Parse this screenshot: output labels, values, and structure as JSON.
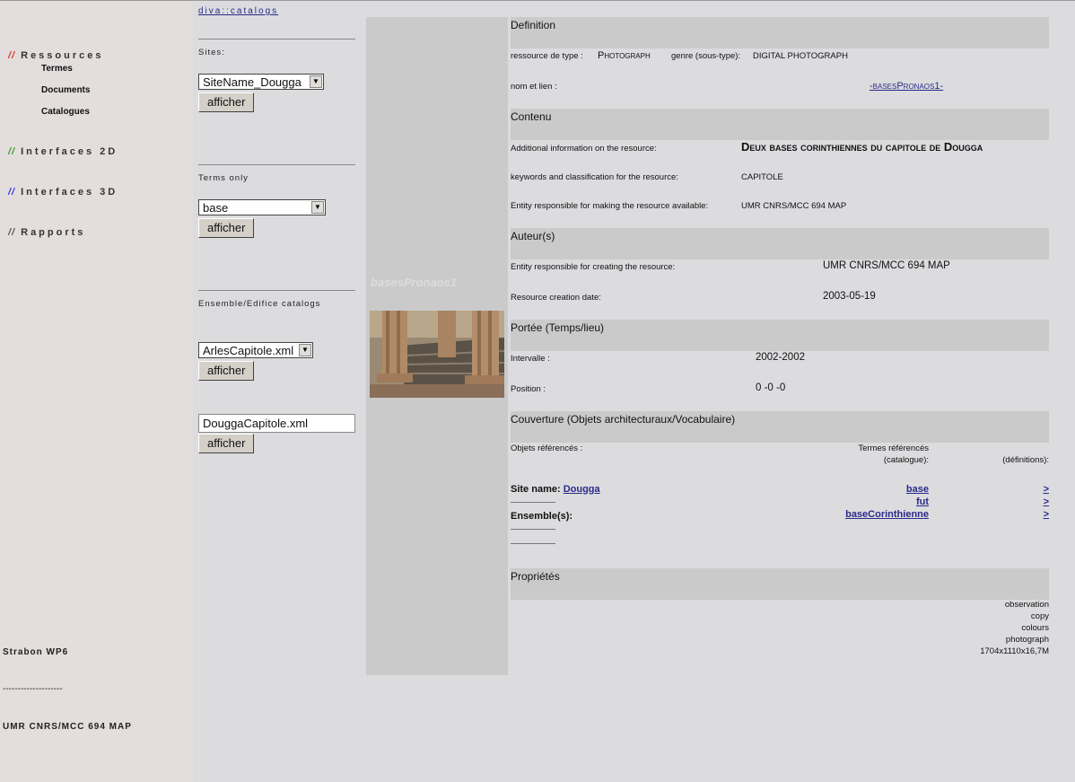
{
  "sidebar": {
    "sections": [
      {
        "slash": "//",
        "slash_color": "#d23a2a",
        "label": "Ressources"
      },
      {
        "slash": "//",
        "slash_color": "#3a9a2a",
        "label": "Interfaces 2D"
      },
      {
        "slash": "//",
        "slash_color": "#3a3ad2",
        "label": "Interfaces 3D"
      },
      {
        "slash": "//",
        "slash_color": "#555555",
        "label": "Rapports"
      }
    ],
    "subitems": [
      "Termes",
      "Documents",
      "Catalogues"
    ],
    "footer": {
      "project": "Strabon WP6",
      "separator": "--------------------",
      "org": "UMR CNRS/MCC 694 MAP"
    }
  },
  "forms": {
    "top_link": "diva::catalogs",
    "sites_label": "Sites:",
    "sites_value": "SiteName_Dougga",
    "terms_label": "Terms only",
    "terms_value": "base",
    "catalogs_label": "Ensemble/Edifice catalogs",
    "catalog_value": "ArlesCapitole.xml",
    "text_value": "DouggaCapitole.xml",
    "button": "afficher"
  },
  "image": {
    "caption": "basesPronaos1"
  },
  "sections": {
    "definition": "Definition",
    "contenu": "Contenu",
    "auteur": "Auteur(s)",
    "portee": "Portée (Temps/lieu)",
    "couverture": "Couverture (Objets architecturaux/Vocabulaire)",
    "proprietes": "Propriétés"
  },
  "definition": {
    "type_label": "ressource de type :",
    "type_value": "Photograph",
    "genre_label": "genre (sous-type):",
    "genre_value": "DIGITAL PHOTOGRAPH",
    "name_label": "nom et lien :",
    "name_link": "-basesPronaos1-"
  },
  "contenu": {
    "info_label": "Additional information on the resource:",
    "info_value": "Deux bases corinthiennes du capitole de Dougga",
    "keywords_label": "keywords and classification for the resource:",
    "keywords_value": "CAPITOLE",
    "avail_label": "Entity responsible for making the resource available:",
    "avail_value": "UMR CNRS/MCC 694 MAP"
  },
  "auteur": {
    "creator_label": "Entity responsible for creating the resource:",
    "creator_value": "UMR CNRS/MCC 694 MAP",
    "date_label": "Resource creation date:",
    "date_value": "2003-05-19"
  },
  "portee": {
    "interval_label": "Intervalle :",
    "interval_value": "2002-2002",
    "position_label": "Position :",
    "position_value": "0 -0 -0"
  },
  "couverture": {
    "objets_label": "Objets référencés :",
    "termes_label": "Termes référencés",
    "catalogue_label": "(catalogue):",
    "definitions_label": "(définitions):",
    "site_label": "Site name:",
    "site_link": "Dougga",
    "ensemble_label": "Ensemble(s):",
    "terms": [
      "base",
      "fut",
      "baseCorinthienne"
    ],
    "def_marker": ">"
  },
  "proprietes": [
    "observation",
    "copy",
    "colours",
    "photograph",
    "1704x1110x16,7M"
  ]
}
